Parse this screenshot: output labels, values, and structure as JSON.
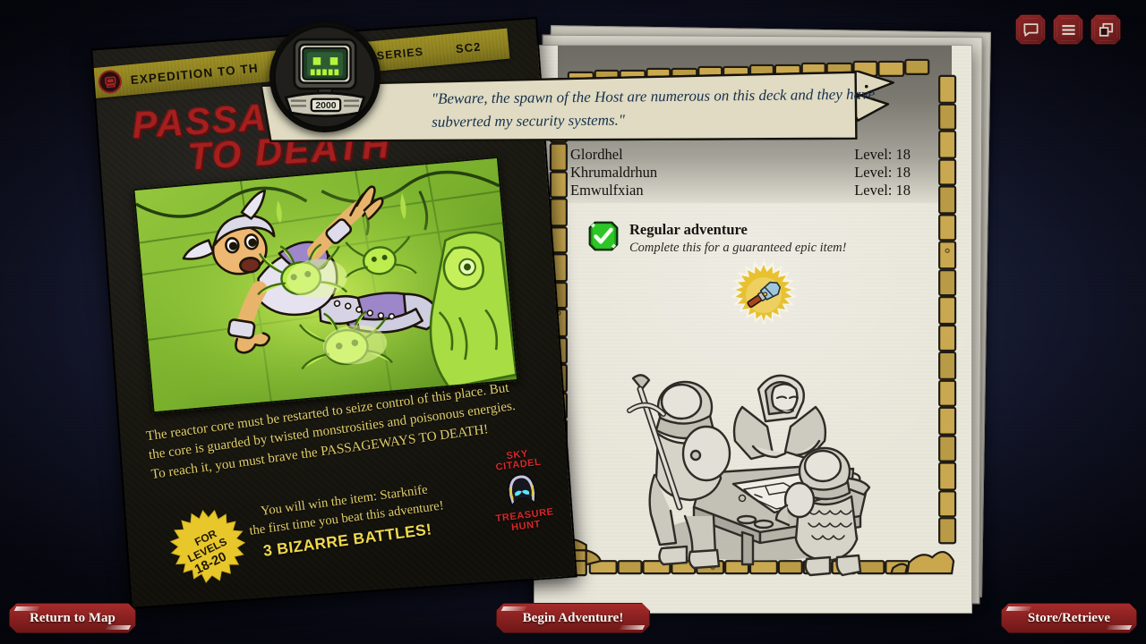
{
  "window": {
    "background_color": "#1b2038",
    "accent_red": "#8e2222"
  },
  "topbar": {
    "buttons": [
      {
        "name": "chat-button",
        "icon": "speech-bubble-icon"
      },
      {
        "name": "menu-button",
        "icon": "hamburger-menu-icon"
      },
      {
        "name": "windows-button",
        "icon": "windows-overlap-icon"
      }
    ]
  },
  "poster": {
    "banner": {
      "emblem_icon": "retro-computer-icon",
      "expedition_label": "EXPEDITION TO TH",
      "series_label": "© SERIES",
      "code_label": "SC2"
    },
    "title_line1": "PASSAGEWAYS",
    "title_line2": "TO DEATH",
    "description": "The reactor core must be restarted to seize control of this place. But the core is guarded by twisted monstrosities and poisonous energies. To reach it, you must brave the PASSAGEWAYS TO DEATH!",
    "item_line1": "You will win the item: Starknife",
    "item_line2": "the first time you beat this adventure!",
    "battles_label": "3 BIZARRE BATTLES!",
    "levels_badge": {
      "line1": "FOR",
      "line2": "LEVELS",
      "line3": "18-20",
      "color": "#e8c72b"
    },
    "treasure_hunt": {
      "line1": "SKY",
      "line2": "CITADEL",
      "line3": "TREASURE",
      "line4": "HUNT",
      "color": "#d7282b"
    }
  },
  "quote": {
    "speaker_icon": "robot-head-icon",
    "robot_label": "2000",
    "text": "\"Beware, the spawn of the Host are numerous on this deck and they have subverted my security systems.\""
  },
  "right_page": {
    "party": {
      "rows": [
        {
          "name": "Glordhel",
          "level": "Level: 18"
        },
        {
          "name": "Khrumaldrhun",
          "level": "Level: 18"
        },
        {
          "name": "Emwulfxian",
          "level": "Level: 18"
        }
      ]
    },
    "adventure_type": {
      "icon": "green-check-icon",
      "title": "Regular adventure",
      "subtitle": "Complete this for a guaranteed epic item!"
    },
    "epic_item": {
      "icon": "starknife-item-icon",
      "burst_color": "#e3bb33"
    },
    "illustration": "adventurers-planning-at-table"
  },
  "footer": {
    "return_to_map": "Return to Map",
    "begin_adventure": "Begin Adventure!",
    "store_retrieve": "Store/Retrieve"
  }
}
